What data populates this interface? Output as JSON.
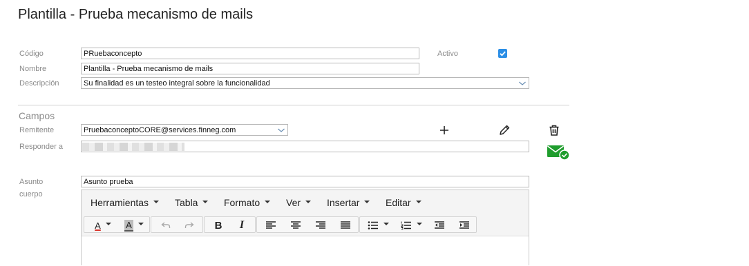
{
  "page": {
    "title": "Plantilla - Prueba mecanismo de mails"
  },
  "form": {
    "codigo_label": "Código",
    "codigo_value": "PRuebaconcepto",
    "nombre_label": "Nombre",
    "nombre_value": "Plantilla - Prueba mecanismo de mails",
    "descripcion_label": "Descripción",
    "descripcion_value": "Su finalidad es un testeo integral sobre la funcionalidad",
    "activo_label": "Activo",
    "activo_checked": true
  },
  "campos": {
    "section_title": "Campos",
    "remitente_label": "Remitente",
    "remitente_value": "PruebaconceptoCORE@services.finneg.com",
    "responder_label": "Responder a",
    "asunto_label": "Asunto",
    "asunto_value": "Asunto prueba",
    "cuerpo_label": "cuerpo"
  },
  "actions": {
    "add_icon": "plus-icon",
    "edit_icon": "pencil-icon",
    "delete_icon": "trash-icon",
    "mail_icon": "mail-check-icon",
    "mail_icon_color": "#1f9d2d"
  },
  "editor": {
    "menus": [
      "Herramientas",
      "Tabla",
      "Formato",
      "Ver",
      "Insertar",
      "Editar"
    ],
    "text_color_button": "A",
    "bg_color_button": "A",
    "bold_button": "B",
    "italic_button": "I"
  },
  "colors": {
    "checkbox": "#2b8ee6",
    "accent_red": "#d9342b"
  }
}
